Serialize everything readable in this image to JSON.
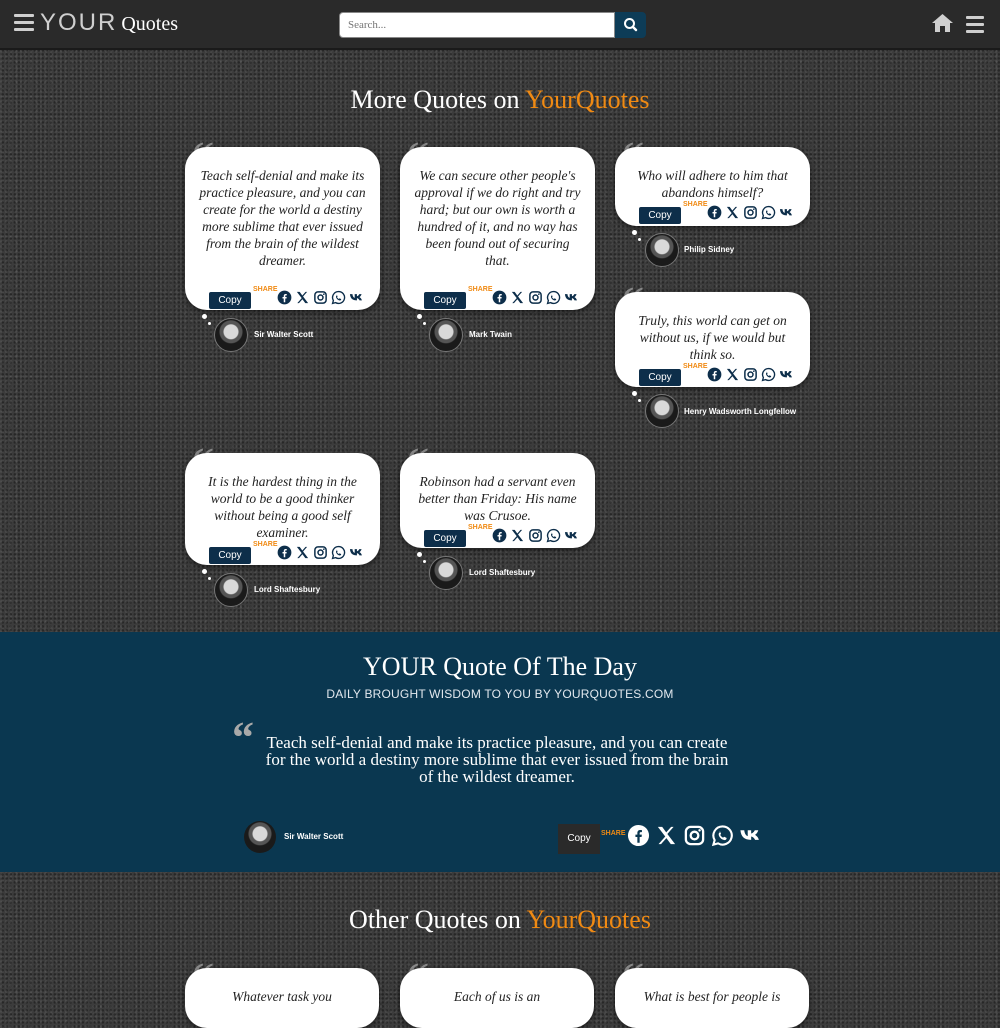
{
  "header": {
    "brand_your": "YOUR",
    "brand_quotes": "Quotes",
    "search_placeholder": "Search..."
  },
  "more_section": {
    "title_prefix": "More Quotes on ",
    "title_accent": "YourQuotes"
  },
  "cards": [
    {
      "text": "Teach self-denial and make its practice pleasure, and you can create for the world a destiny more sublime that ever issued from the brain of the wildest dreamer.",
      "author": "Sir Walter Scott"
    },
    {
      "text": "We can secure other people's approval if we do right and try hard; but our own is worth a hundred of it, and no way has been found out of securing that.",
      "author": "Mark Twain"
    },
    {
      "text": "Who will adhere to him that abandons himself?",
      "author": "Philip Sidney"
    },
    {
      "text": "Truly, this world can get on without us, if we would but think so.",
      "author": "Henry Wadsworth Longfellow"
    },
    {
      "text": "It is the hardest thing in the world to be a good thinker without being a good self examiner.",
      "author": "Lord Shaftesbury"
    },
    {
      "text": "Robinson had a servant even better than Friday: His name was Crusoe.",
      "author": "Lord Shaftesbury"
    }
  ],
  "card_actions": {
    "copy_label": "Copy",
    "share_label": "SHARE"
  },
  "qotd": {
    "title": "YOUR Quote Of The Day",
    "subtitle": "DAILY BROUGHT WISDOM TO YOU BY YOURQUOTES.COM",
    "text": "Teach self-denial and make its practice pleasure, and you can create for the world a destiny more sublime that ever issued from the brain of the wildest dreamer.",
    "author": "Sir Walter Scott",
    "copy_label": "Copy",
    "share_label": "SHARE"
  },
  "other_section": {
    "title_prefix": "Other Quotes on ",
    "title_accent": "YourQuotes"
  },
  "other_cards": [
    {
      "text": "Whatever task you"
    },
    {
      "text": "Each of us is an"
    },
    {
      "text": "What is best for people is"
    }
  ],
  "colors": {
    "accent": "#f08a13",
    "band": "#0a3750",
    "copy_button": "#0d2e4a"
  },
  "icons": [
    "menu-icon",
    "home-icon",
    "search-icon",
    "facebook-icon",
    "x-icon",
    "instagram-icon",
    "whatsapp-icon",
    "vk-icon"
  ]
}
